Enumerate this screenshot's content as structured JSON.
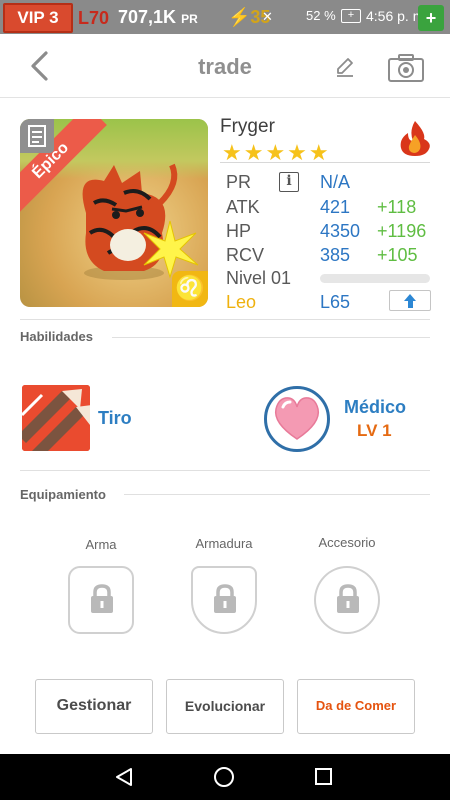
{
  "status_bar": {
    "vip": "VIP 3",
    "level": "L70",
    "coins": "707,1K",
    "coins_suffix": "PR",
    "energy": "35",
    "battery_percent": "52 %",
    "time": "4:56 p. m.",
    "plus": "+"
  },
  "header": {
    "title": "trade"
  },
  "monster": {
    "rarity": "Épico",
    "name": "Fryger",
    "stars": "★★★★★",
    "zodiac_symbol": "♌",
    "stats": {
      "pr_label": "PR",
      "pr_value": "N/A",
      "atk_label": "ATK",
      "atk_value": "421",
      "atk_bonus": "+118",
      "hp_label": "HP",
      "hp_value": "4350",
      "hp_bonus": "+1196",
      "rcv_label": "RCV",
      "rcv_value": "385",
      "rcv_bonus": "+105",
      "level_label": "Nivel 01",
      "level_progress": 0,
      "zodiac": "Leo",
      "max_level": "L65"
    },
    "info_icon": "i"
  },
  "skills": {
    "title": "Habilidades",
    "skill1": {
      "name": "Tiro"
    },
    "skill2": {
      "name": "Médico",
      "level": "LV 1"
    }
  },
  "equipment": {
    "title": "Equipamiento",
    "slots": [
      {
        "label": "Arma"
      },
      {
        "label": "Armadura"
      },
      {
        "label": "Accesorio"
      }
    ]
  },
  "actions": {
    "manage": "Gestionar",
    "evolve": "Evolucionar",
    "feed": "Da de Comer"
  },
  "colors": {
    "accent_blue": "#2c76c3",
    "bonus_green": "#5fbd42",
    "feed_orange": "#e5530f",
    "ribbon_red": "#ec5b49",
    "star_yellow": "#f6c21b"
  }
}
